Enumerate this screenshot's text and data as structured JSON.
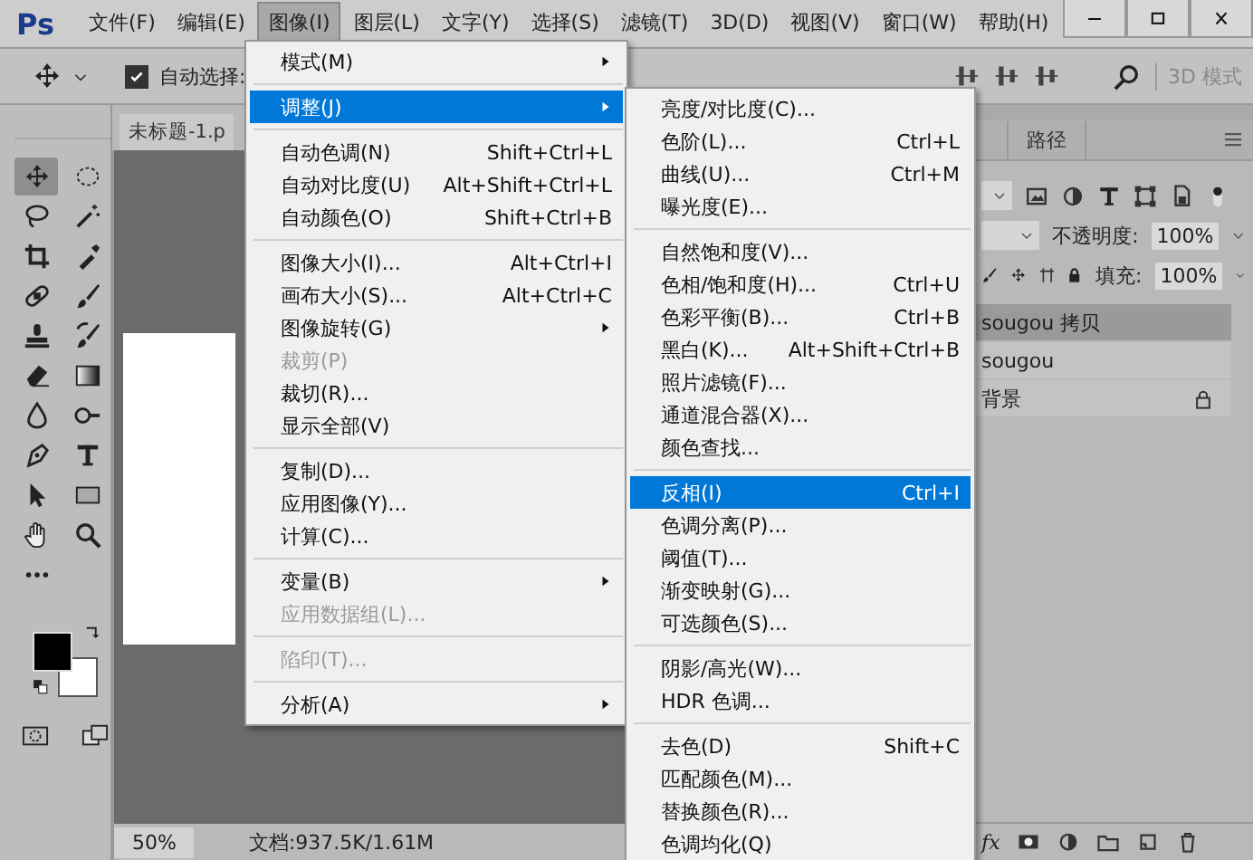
{
  "app": {
    "logo": "Ps"
  },
  "menubar": [
    {
      "label": "文件(F)",
      "selected": false
    },
    {
      "label": "编辑(E)",
      "selected": false
    },
    {
      "label": "图像(I)",
      "selected": true
    },
    {
      "label": "图层(L)",
      "selected": false
    },
    {
      "label": "文字(Y)",
      "selected": false
    },
    {
      "label": "选择(S)",
      "selected": false
    },
    {
      "label": "滤镜(T)",
      "selected": false
    },
    {
      "label": "3D(D)",
      "selected": false
    },
    {
      "label": "视图(V)",
      "selected": false
    },
    {
      "label": "窗口(W)",
      "selected": false
    },
    {
      "label": "帮助(H)",
      "selected": false
    }
  ],
  "options_bar": {
    "auto_select": {
      "label": "自动选择:",
      "checked": true
    },
    "mode_label": "3D 模式"
  },
  "toolbar": {
    "tools": [
      {
        "kind": "move",
        "selected": true
      },
      {
        "kind": "marquee",
        "selected": false
      },
      {
        "kind": "lasso",
        "selected": false
      },
      {
        "kind": "wand",
        "selected": false
      },
      {
        "kind": "crop",
        "selected": false
      },
      {
        "kind": "eyedropper",
        "selected": false
      },
      {
        "kind": "heal",
        "selected": false
      },
      {
        "kind": "brush",
        "selected": false
      },
      {
        "kind": "stamp",
        "selected": false
      },
      {
        "kind": "history",
        "selected": false
      },
      {
        "kind": "eraser",
        "selected": false
      },
      {
        "kind": "gradient",
        "selected": false
      },
      {
        "kind": "blur",
        "selected": false
      },
      {
        "kind": "dodge",
        "selected": false
      },
      {
        "kind": "pen",
        "selected": false
      },
      {
        "kind": "type",
        "selected": false
      },
      {
        "kind": "pointer",
        "selected": false
      },
      {
        "kind": "rectangle",
        "selected": false
      },
      {
        "kind": "hand",
        "selected": false
      },
      {
        "kind": "zoom",
        "selected": false
      },
      {
        "kind": "more",
        "selected": false
      }
    ]
  },
  "document": {
    "tab": "未标题-1.p"
  },
  "image_menu": {
    "groups": [
      [
        {
          "label": "模式(M)",
          "submenu": true,
          "disabled": false,
          "selected": false
        }
      ],
      [
        {
          "label": "调整(J)",
          "submenu": true,
          "disabled": false,
          "selected": true
        }
      ],
      [
        {
          "label": "自动色调(N)",
          "shortcut": "Shift+Ctrl+L",
          "submenu": false,
          "disabled": false,
          "selected": false
        },
        {
          "label": "自动对比度(U)",
          "shortcut": "Alt+Shift+Ctrl+L",
          "submenu": false,
          "disabled": false,
          "selected": false
        },
        {
          "label": "自动颜色(O)",
          "shortcut": "Shift+Ctrl+B",
          "submenu": false,
          "disabled": false,
          "selected": false
        }
      ],
      [
        {
          "label": "图像大小(I)...",
          "shortcut": "Alt+Ctrl+I",
          "submenu": false,
          "disabled": false,
          "selected": false
        },
        {
          "label": "画布大小(S)...",
          "shortcut": "Alt+Ctrl+C",
          "submenu": false,
          "disabled": false,
          "selected": false
        },
        {
          "label": "图像旋转(G)",
          "submenu": true,
          "disabled": false,
          "selected": false
        },
        {
          "label": "裁剪(P)",
          "submenu": false,
          "disabled": true,
          "selected": false
        },
        {
          "label": "裁切(R)...",
          "submenu": false,
          "disabled": false,
          "selected": false
        },
        {
          "label": "显示全部(V)",
          "submenu": false,
          "disabled": false,
          "selected": false
        }
      ],
      [
        {
          "label": "复制(D)...",
          "submenu": false,
          "disabled": false,
          "selected": false
        },
        {
          "label": "应用图像(Y)...",
          "submenu": false,
          "disabled": false,
          "selected": false
        },
        {
          "label": "计算(C)...",
          "submenu": false,
          "disabled": false,
          "selected": false
        }
      ],
      [
        {
          "label": "变量(B)",
          "submenu": true,
          "disabled": false,
          "selected": false
        },
        {
          "label": "应用数据组(L)...",
          "submenu": false,
          "disabled": true,
          "selected": false
        }
      ],
      [
        {
          "label": "陷印(T)...",
          "submenu": false,
          "disabled": true,
          "selected": false
        }
      ],
      [
        {
          "label": "分析(A)",
          "submenu": true,
          "disabled": false,
          "selected": false
        }
      ]
    ]
  },
  "adjust_submenu": {
    "groups": [
      [
        {
          "label": "亮度/对比度(C)...",
          "selected": false
        },
        {
          "label": "色阶(L)...",
          "shortcut": "Ctrl+L",
          "selected": false
        },
        {
          "label": "曲线(U)...",
          "shortcut": "Ctrl+M",
          "selected": false
        },
        {
          "label": "曝光度(E)...",
          "selected": false
        }
      ],
      [
        {
          "label": "自然饱和度(V)...",
          "selected": false
        },
        {
          "label": "色相/饱和度(H)...",
          "shortcut": "Ctrl+U",
          "selected": false
        },
        {
          "label": "色彩平衡(B)...",
          "shortcut": "Ctrl+B",
          "selected": false
        },
        {
          "label": "黑白(K)...",
          "shortcut": "Alt+Shift+Ctrl+B",
          "selected": false
        },
        {
          "label": "照片滤镜(F)...",
          "selected": false
        },
        {
          "label": "通道混合器(X)...",
          "selected": false
        },
        {
          "label": "颜色查找...",
          "selected": false
        }
      ],
      [
        {
          "label": "反相(I)",
          "shortcut": "Ctrl+I",
          "selected": true
        },
        {
          "label": "色调分离(P)...",
          "selected": false
        },
        {
          "label": "阈值(T)...",
          "selected": false
        },
        {
          "label": "渐变映射(G)...",
          "selected": false
        },
        {
          "label": "可选颜色(S)...",
          "selected": false
        }
      ],
      [
        {
          "label": "阴影/高光(W)...",
          "selected": false
        },
        {
          "label": "HDR 色调...",
          "selected": false
        }
      ],
      [
        {
          "label": "去色(D)",
          "shortcut": "Shift+C",
          "selected": false
        },
        {
          "label": "匹配颜色(M)...",
          "selected": false
        },
        {
          "label": "替换颜色(R)...",
          "selected": false
        },
        {
          "label": "色调均化(Q)",
          "selected": false
        }
      ]
    ]
  },
  "layers_panel": {
    "tab": "路径",
    "opacity_label": "不透明度:",
    "opacity": "100%",
    "fill_label": "填充:",
    "fill": "100%",
    "fx": "fx",
    "layers": [
      {
        "name": "sougou 拷贝",
        "selected": true,
        "locked": false
      },
      {
        "name": "sougou",
        "selected": false,
        "locked": false
      },
      {
        "name": "背景",
        "selected": false,
        "locked": true
      }
    ]
  },
  "status_bar": {
    "zoom": "50%",
    "doc_info": "文档:937.5K/1.61M"
  }
}
